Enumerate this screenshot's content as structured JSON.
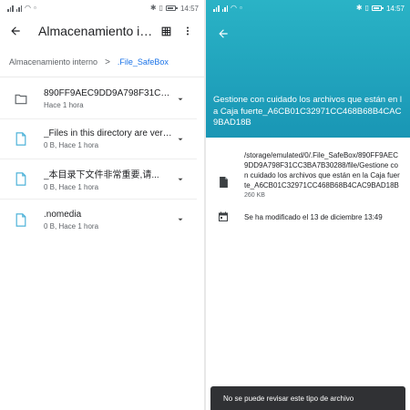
{
  "left": {
    "status": {
      "time": "14:57"
    },
    "appbar": {
      "title": "Almacenamiento in..."
    },
    "breadcrumb": {
      "root": "Almacenamiento interno",
      "separator": ">",
      "current": ".File_SafeBox"
    },
    "files": [
      {
        "name": "890FF9AEC9DD9A798F31CC...",
        "meta": "Hace 1 hora",
        "icon": "folder-icon"
      },
      {
        "name": "_Files in this directory are very...",
        "meta": "0 B, Hace 1 hora",
        "icon": "document-icon"
      },
      {
        "name": "_本目录下文件非常重要,请...",
        "meta": "0 B, Hace 1 hora",
        "icon": "document-icon"
      },
      {
        "name": ".nomedia",
        "meta": "0 B, Hace 1 hora",
        "icon": "document-icon"
      }
    ],
    "colors": {
      "accent": "#1a73e8",
      "icon": "#4fb3d9"
    }
  },
  "right": {
    "status": {
      "time": "14:57"
    },
    "header": {
      "title": "Gestione con cuidado los archivos que están en la Caja fuerte_A6CB01C32971CC468B68B4CAC9BAD18B",
      "color": "#1da2bd"
    },
    "details": {
      "path": "/storage/emulated/0/.File_SafeBox/890FF9AEC9DD9A798F31CC3BA7B30288/file/Gestione con cuidado los archivos que están en la Caja fuerte_A6CB01C32971CC468B68B4CAC9BAD18B",
      "size": "260 KB",
      "modified": "Se ha modificado el 13 de diciembre 13:49"
    },
    "snackbar": {
      "message": "No se puede revisar este tipo de archivo"
    }
  }
}
